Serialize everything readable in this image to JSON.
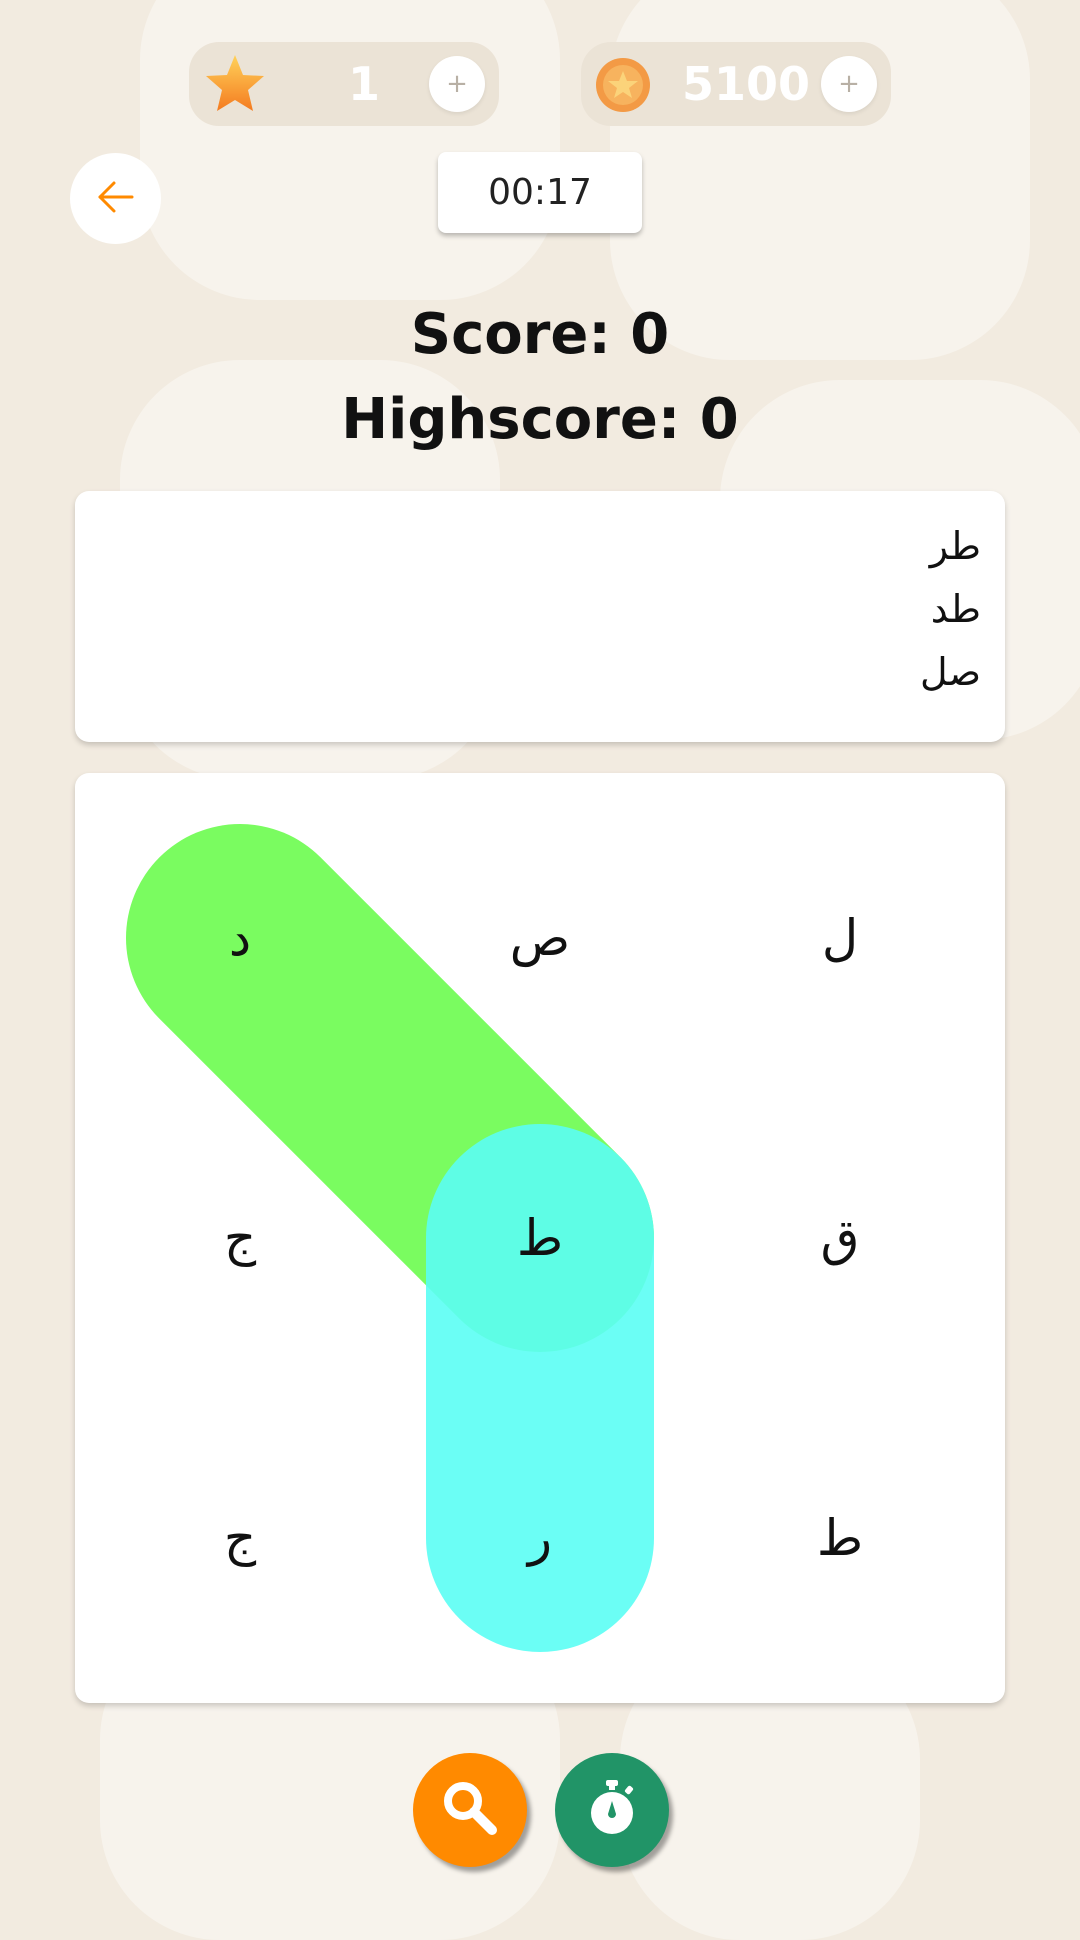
{
  "currency": {
    "stars": {
      "icon": "star-icon",
      "value": "1",
      "plus_label": "+"
    },
    "coins": {
      "icon": "coin-icon",
      "value": "5100",
      "plus_label": "+"
    }
  },
  "header": {
    "back_icon": "arrow-left-icon",
    "timer": "00:17"
  },
  "score": {
    "score_text": "Score: 0",
    "highscore_text": "Highscore: 0"
  },
  "words": [
    "طر",
    "طد",
    "صل"
  ],
  "grid": {
    "rows": 3,
    "cols": 3,
    "letters": [
      "د",
      "ص",
      "ل",
      "ج",
      "ط",
      "ق",
      "ج",
      "ر",
      "ط"
    ]
  },
  "found_paths": [
    {
      "from": [
        0,
        0
      ],
      "to": [
        1,
        1
      ],
      "color": "#6cfc4f"
    },
    {
      "from": [
        1,
        1
      ],
      "to": [
        2,
        1
      ],
      "color": "#5cfef4"
    }
  ],
  "tools": {
    "hint_icon": "magnifier-icon",
    "time_icon": "stopwatch-icon",
    "hint_color": "#ff8a00",
    "time_color": "#219467"
  },
  "colors": {
    "accent": "#ff8a00",
    "background": "#f2ebe0"
  }
}
